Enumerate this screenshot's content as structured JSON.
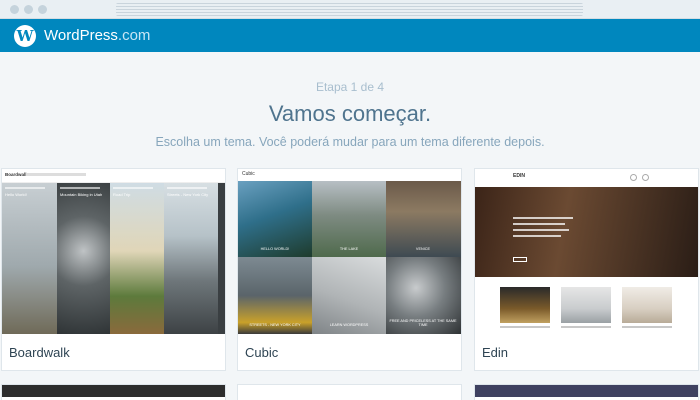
{
  "masterbar": {
    "logo_letter": "W",
    "brand_name": "WordPress",
    "brand_tld": ".com"
  },
  "signup": {
    "step": "Etapa 1 de 4",
    "heading": "Vamos começar.",
    "subheading": "Escolha um tema. Você poderá mudar para um tema diferente depois."
  },
  "themes": [
    {
      "name": "Boardwalk",
      "preview_title": "Boardwalk",
      "post_titles": [
        "Hello World!",
        "Mountain Biking in Utah",
        "Road Trip",
        "Streets - New York City"
      ]
    },
    {
      "name": "Cubic",
      "preview_title": "Cubic",
      "post_titles": [
        "HELLO WORLD!",
        "THE LAKE",
        "VENICE",
        "STREETS - NEW YORK CITY",
        "LEARN WORDPRESS",
        "FREE AND PRICELESS AT THE SAME TIME"
      ]
    },
    {
      "name": "Edin",
      "preview_title": "EDIN",
      "button_label": "BUTTON"
    }
  ],
  "colors": {
    "masterbar": "#0087be",
    "background": "#f3f6f8",
    "heading": "#4f748e"
  }
}
